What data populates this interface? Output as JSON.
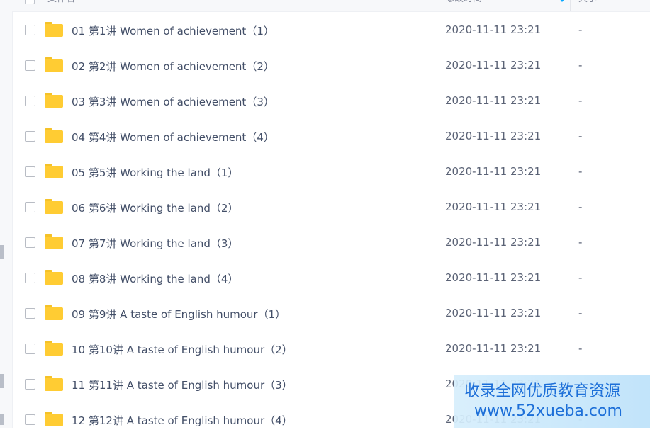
{
  "header": {
    "name_label": "文件名",
    "modified_label": "修改时间",
    "size_label": "大小"
  },
  "files": [
    {
      "name": "01 第1讲 Women of achievement（1）",
      "modified": "2020-11-11 23:21",
      "size": "-"
    },
    {
      "name": "02 第2讲 Women of achievement（2）",
      "modified": "2020-11-11 23:21",
      "size": "-"
    },
    {
      "name": "03 第3讲 Women of achievement（3）",
      "modified": "2020-11-11 23:21",
      "size": "-"
    },
    {
      "name": "04 第4讲 Women of achievement（4）",
      "modified": "2020-11-11 23:21",
      "size": "-"
    },
    {
      "name": "05 第5讲 Working the land（1）",
      "modified": "2020-11-11 23:21",
      "size": "-"
    },
    {
      "name": "06 第6讲 Working the land（2）",
      "modified": "2020-11-11 23:21",
      "size": "-"
    },
    {
      "name": "07 第7讲 Working the land（3）",
      "modified": "2020-11-11 23:21",
      "size": "-"
    },
    {
      "name": "08 第8讲 Working the land（4）",
      "modified": "2020-11-11 23:21",
      "size": "-"
    },
    {
      "name": "09 第9讲 A taste of English humour（1）",
      "modified": "2020-11-11 23:21",
      "size": "-"
    },
    {
      "name": "10 第10讲 A taste of English humour（2）",
      "modified": "2020-11-11 23:21",
      "size": "-"
    },
    {
      "name": "11 第11讲 A taste of English humour（3）",
      "modified": "2020-11-11 23:21",
      "size": "-"
    },
    {
      "name": "12 第12讲 A taste of English humour（4）",
      "modified": "2020-11-11 23:21",
      "size": "-"
    }
  ],
  "watermark": {
    "line1": "收录全网优质教育资源",
    "line2": "www.52xueba.com"
  },
  "colors": {
    "folder": "#ffcc33",
    "accent": "#06a7ff",
    "watermark_text": "#1d6fd8"
  },
  "icons": {
    "folder": "folder-icon",
    "sort": "sort-down-icon"
  }
}
